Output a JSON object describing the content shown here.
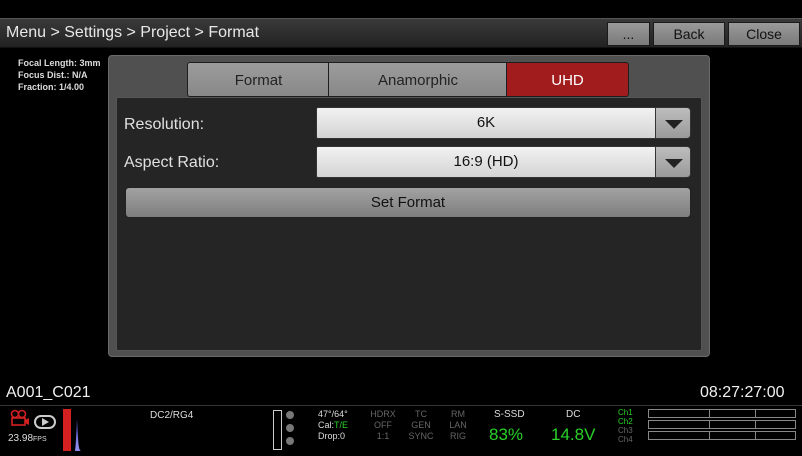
{
  "titlebar": {
    "breadcrumb": "Menu > Settings > Project > Format",
    "more_label": "...",
    "back_label": "Back",
    "close_label": "Close"
  },
  "lens_info": {
    "focal_length": "Focal Length: 3mm",
    "focus_dist": "Focus Dist.: N/A",
    "fraction": "Fraction: 1/4.00"
  },
  "dialog": {
    "tabs": [
      {
        "label": "Format",
        "active": false
      },
      {
        "label": "Anamorphic",
        "active": false
      },
      {
        "label": "UHD",
        "active": true
      }
    ],
    "resolution_label": "Resolution:",
    "resolution_value": "6K",
    "aspect_label": "Aspect Ratio:",
    "aspect_value": "16:9 (HD)",
    "set_format_label": "Set Format"
  },
  "clip_name": "A001_C021",
  "timecode": "08:27:27:00",
  "status": {
    "fps": "23.98",
    "fps_unit": "FPS",
    "codec": "DC2/RG4",
    "temp": "47°/64°",
    "cal_prefix": "Cal:",
    "cal_value": "T/E",
    "drop": "Drop:0",
    "hdrx": "HDRX",
    "hdrx_val": "OFF",
    "hdrx_ratio": "1:1",
    "tc": "TC",
    "tc_val": "GEN",
    "tc_sync": "SYNC",
    "rm": "RM",
    "rm_val": "LAN",
    "rm_rig": "RIG",
    "ssd_label": "S-SSD",
    "ssd_value": "83%",
    "dc_label": "DC",
    "dc_value": "14.8V",
    "channels": [
      "Ch1",
      "Ch2",
      "Ch3",
      "Ch4"
    ]
  },
  "colors": {
    "active_tab": "#a11c1c",
    "status_green": "#29d129",
    "record_red": "#d42020"
  }
}
